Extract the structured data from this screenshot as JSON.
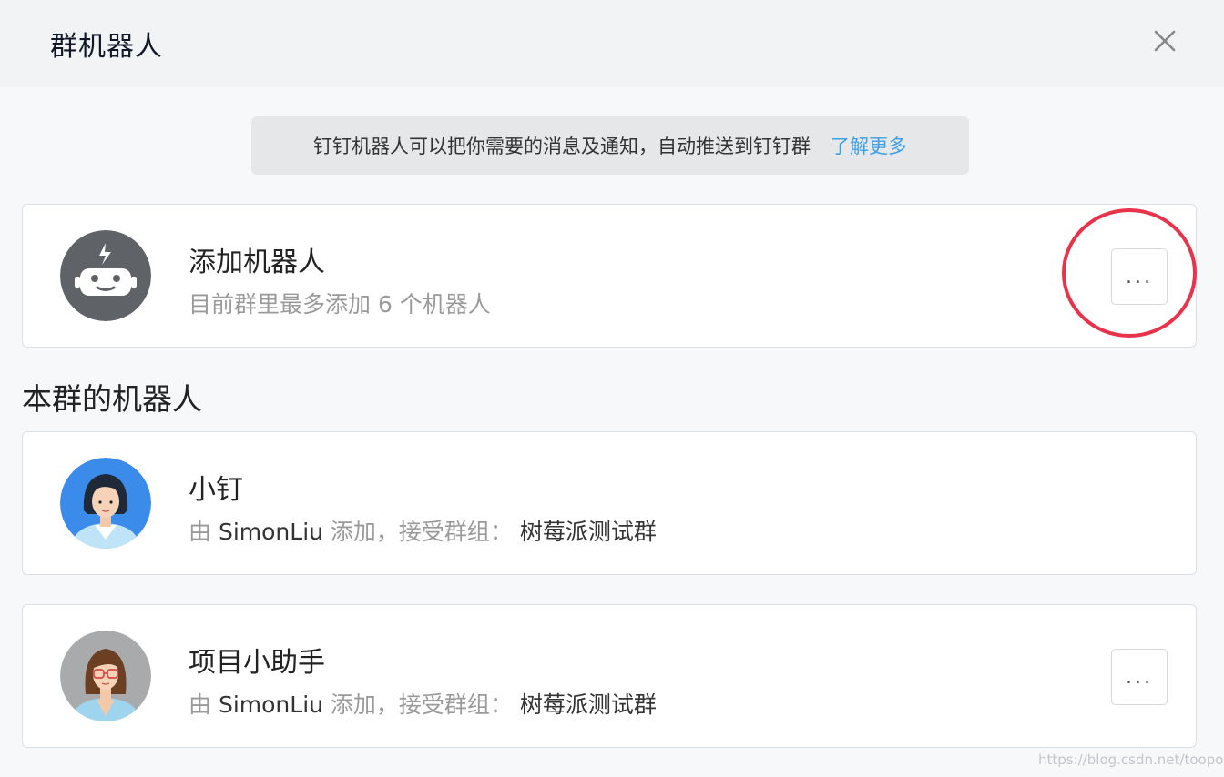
{
  "dialog": {
    "title": "群机器人",
    "close_icon": "close-icon"
  },
  "notice": {
    "text": "钉钉机器人可以把你需要的消息及通知，自动推送到钉钉群",
    "link": "了解更多"
  },
  "add_robot": {
    "name": "添加机器人",
    "desc": "目前群里最多添加 6 个机器人",
    "more_label": "..."
  },
  "section": {
    "title": "本群的机器人"
  },
  "robots": [
    {
      "name": "小钉",
      "prefix": "由 ",
      "user": "SimonLiu",
      "mid": " 添加，接受群组：  ",
      "group": "树莓派测试群"
    },
    {
      "name": "项目小助手",
      "prefix": "由 ",
      "user": "SimonLiu",
      "mid": " 添加，接受群组：  ",
      "group": "树莓派测试群",
      "more_label": "..."
    }
  ],
  "watermark": "https://blog.csdn.net/toopoo",
  "colors": {
    "link": "#3d9fe6",
    "highlight_ring": "#e8334a",
    "robot_avatar_bg": "#5f6368",
    "avatar1_bg": "#3b8beb",
    "avatar2_bg": "#a9aaac"
  }
}
